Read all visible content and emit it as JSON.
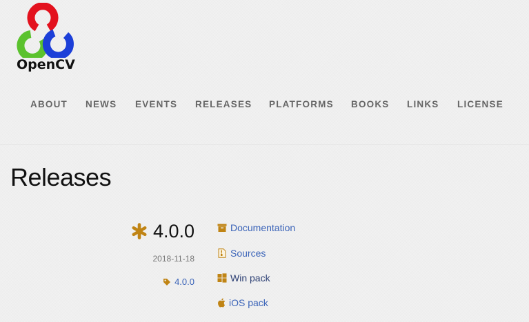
{
  "logo": {
    "text": "OpenCV",
    "colors": {
      "red": "#e3111d",
      "green": "#5bc22e",
      "blue": "#1c3fd8"
    }
  },
  "nav": {
    "items": [
      "ABOUT",
      "NEWS",
      "EVENTS",
      "RELEASES",
      "PLATFORMS",
      "BOOKS",
      "LINKS",
      "LICENSE"
    ]
  },
  "page": {
    "title": "Releases"
  },
  "release": {
    "version": "4.0.0",
    "date": "2018-11-18",
    "tag": "4.0.0",
    "links": {
      "documentation": "Documentation",
      "sources": "Sources",
      "win_pack": "Win pack",
      "ios_pack": "iOS pack"
    }
  },
  "colors": {
    "link": "#3a63b8",
    "link_visited": "#2c3f73",
    "accent_icon": "#c08414",
    "nav_text": "#666666"
  },
  "icons": {
    "release_star": "asterisk-icon",
    "tag": "tag-icon",
    "documentation": "archive-box-icon",
    "sources": "file-zip-icon",
    "win_pack": "windows-icon",
    "ios_pack": "apple-icon"
  }
}
